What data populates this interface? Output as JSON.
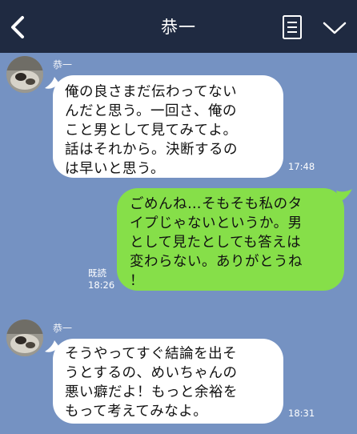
{
  "header": {
    "title": "恭一"
  },
  "messages": [
    {
      "sender": "恭一",
      "lines": [
        "俺の良さまだ伝わってない",
        "んだと思う。一回さ、俺の",
        "こと男として見てみてよ。",
        "話はそれから。決断するの",
        "は早いと思う。"
      ],
      "time": "17:48"
    },
    {
      "sender": "me",
      "lines": [
        "ごめんね…そもそも私のタ",
        "イプじゃないというか。男",
        "として見たとしても答えは",
        "変わらない。ありがとうね",
        "！"
      ],
      "read": "既読",
      "time": "18:26"
    },
    {
      "sender": "恭一",
      "lines": [
        "そうやってすぐ結論を出そ",
        "うとするの、めいちゃんの",
        "悪い癖だよ！もっと余裕を",
        "もって考えてみなよ。"
      ],
      "time": "18:31"
    }
  ],
  "colors": {
    "header_bg": "#1f2a41",
    "chat_bg": "#7592c2",
    "bubble_incoming": "#ffffff",
    "bubble_outgoing": "#86df49"
  },
  "icons": [
    "back-arrow-icon",
    "notes-icon",
    "chevron-down-icon"
  ]
}
